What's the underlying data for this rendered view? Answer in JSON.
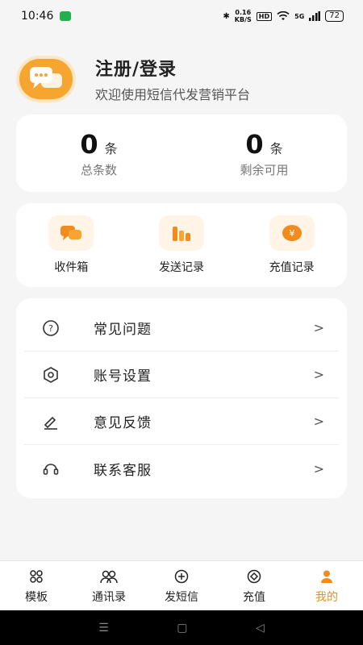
{
  "status_bar": {
    "time": "10:46",
    "speed_value": "0.16",
    "speed_unit": "KB/S",
    "hd": "HD",
    "signal": "5G",
    "battery": "72"
  },
  "profile": {
    "title": "注册/登录",
    "subtitle": "欢迎使用短信代发营销平台",
    "avatar_icon": "chat-bubbles-icon"
  },
  "stats": [
    {
      "value": "0",
      "unit": "条",
      "label": "总条数"
    },
    {
      "value": "0",
      "unit": "条",
      "label": "剩余可用"
    }
  ],
  "shortcuts": [
    {
      "label": "收件箱",
      "icon": "inbox-icon"
    },
    {
      "label": "发送记录",
      "icon": "send-record-icon"
    },
    {
      "label": "充值记录",
      "icon": "recharge-record-icon"
    }
  ],
  "menu": [
    {
      "label": "常见问题",
      "icon": "question-icon",
      "arrow": ">"
    },
    {
      "label": "账号设置",
      "icon": "settings-icon",
      "arrow": ">"
    },
    {
      "label": "意见反馈",
      "icon": "feedback-icon",
      "arrow": ">"
    },
    {
      "label": "联系客服",
      "icon": "headset-icon",
      "arrow": ">"
    }
  ],
  "tabs": [
    {
      "label": "模板",
      "icon": "template-icon"
    },
    {
      "label": "通讯录",
      "icon": "contacts-icon"
    },
    {
      "label": "发短信",
      "icon": "send-sms-icon"
    },
    {
      "label": "充值",
      "icon": "recharge-icon"
    },
    {
      "label": "我的",
      "icon": "profile-icon",
      "active": true
    }
  ],
  "colors": {
    "accent": "#f28b1e",
    "avatar_bg": "#f6a531",
    "page_bg": "#f5f5f5"
  }
}
